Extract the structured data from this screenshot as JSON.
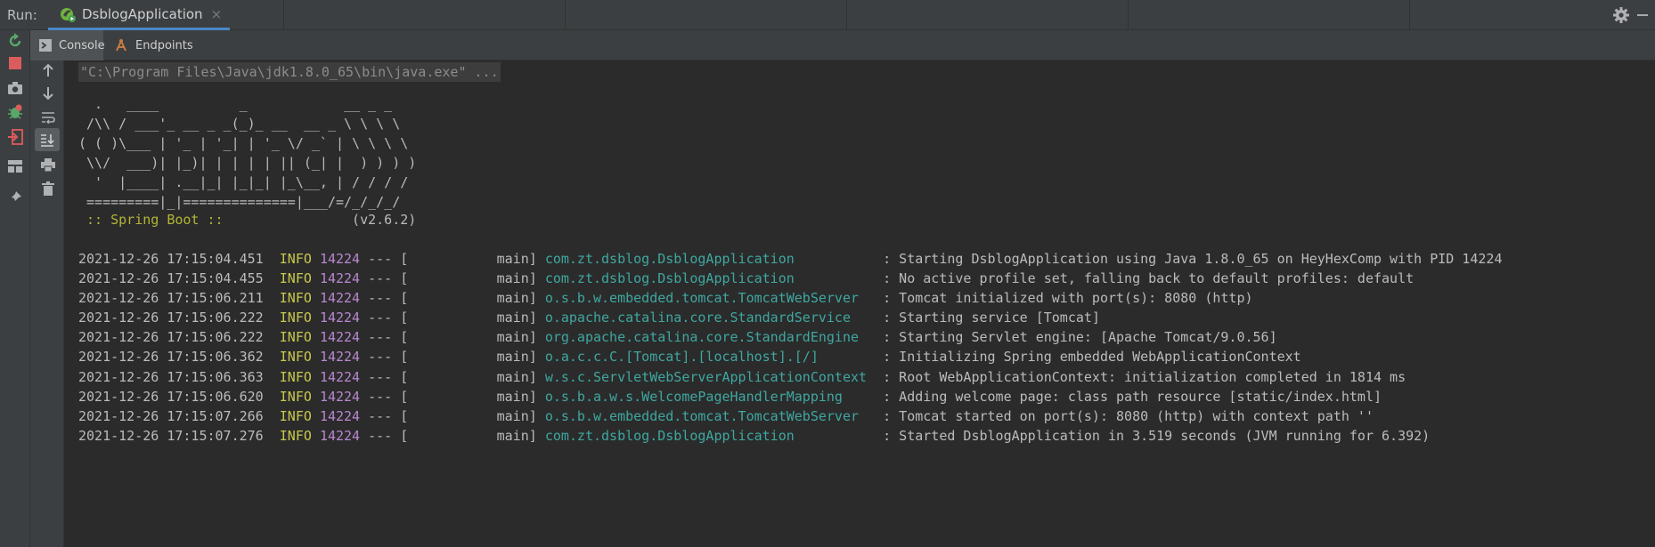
{
  "runbar": {
    "label": "Run:",
    "tab_title": "DsblogApplication",
    "close_glyph": "×"
  },
  "subtabs": [
    {
      "label": "Console",
      "icon": "console-icon"
    },
    {
      "label": "Endpoints",
      "icon": "endpoints-icon"
    }
  ],
  "console": {
    "command": "\"C:\\Program Files\\Java\\jdk1.8.0_65\\bin\\java.exe\" ...",
    "banner": "  .   ____          _            __ _ _\n /\\\\ / ___'_ __ _ _(_)_ __  __ _ \\ \\ \\ \\\n( ( )\\___ | '_ | '_| | '_ \\/ _` | \\ \\ \\ \\\n \\\\/  ___)| |_)| | | | | || (_| |  ) ) ) )\n  '  |____| .__|_| |_|_| |_\\__, | / / / /\n =========|_|==============|___/=/_/_/_/",
    "spring_label": " :: Spring Boot :: ",
    "spring_version": "               (v2.6.2)",
    "logs": [
      {
        "ts": "2021-12-26 17:15:04.451",
        "level": "INFO",
        "pid": "14224",
        "thread": " --- [           main] ",
        "logger": "com.zt.dsblog.DsblogApplication          ",
        "msg": " : Starting DsblogApplication using Java 1.8.0_65 on HeyHexComp with PID 14224"
      },
      {
        "ts": "2021-12-26 17:15:04.455",
        "level": "INFO",
        "pid": "14224",
        "thread": " --- [           main] ",
        "logger": "com.zt.dsblog.DsblogApplication          ",
        "msg": " : No active profile set, falling back to default profiles: default"
      },
      {
        "ts": "2021-12-26 17:15:06.211",
        "level": "INFO",
        "pid": "14224",
        "thread": " --- [           main] ",
        "logger": "o.s.b.w.embedded.tomcat.TomcatWebServer  ",
        "msg": " : Tomcat initialized with port(s): 8080 (http)"
      },
      {
        "ts": "2021-12-26 17:15:06.222",
        "level": "INFO",
        "pid": "14224",
        "thread": " --- [           main] ",
        "logger": "o.apache.catalina.core.StandardService   ",
        "msg": " : Starting service [Tomcat]"
      },
      {
        "ts": "2021-12-26 17:15:06.222",
        "level": "INFO",
        "pid": "14224",
        "thread": " --- [           main] ",
        "logger": "org.apache.catalina.core.StandardEngine  ",
        "msg": " : Starting Servlet engine: [Apache Tomcat/9.0.56]"
      },
      {
        "ts": "2021-12-26 17:15:06.362",
        "level": "INFO",
        "pid": "14224",
        "thread": " --- [           main] ",
        "logger": "o.a.c.c.C.[Tomcat].[localhost].[/]       ",
        "msg": " : Initializing Spring embedded WebApplicationContext"
      },
      {
        "ts": "2021-12-26 17:15:06.363",
        "level": "INFO",
        "pid": "14224",
        "thread": " --- [           main] ",
        "logger": "w.s.c.ServletWebServerApplicationContext ",
        "msg": " : Root WebApplicationContext: initialization completed in 1814 ms"
      },
      {
        "ts": "2021-12-26 17:15:06.620",
        "level": "INFO",
        "pid": "14224",
        "thread": " --- [           main] ",
        "logger": "o.s.b.a.w.s.WelcomePageHandlerMapping    ",
        "msg": " : Adding welcome page: class path resource [static/index.html]"
      },
      {
        "ts": "2021-12-26 17:15:07.266",
        "level": "INFO",
        "pid": "14224",
        "thread": " --- [           main] ",
        "logger": "o.s.b.w.embedded.tomcat.TomcatWebServer  ",
        "msg": " : Tomcat started on port(s): 8080 (http) with context path ''"
      },
      {
        "ts": "2021-12-26 17:15:07.276",
        "level": "INFO",
        "pid": "14224",
        "thread": " --- [           main] ",
        "logger": "com.zt.dsblog.DsblogApplication          ",
        "msg": " : Started DsblogApplication in 3.519 seconds (JVM running for 6.392)"
      }
    ]
  },
  "colors": {
    "background": "#2b2b2b",
    "panel": "#3c3f41",
    "accent": "#4a88c7",
    "level": "#c8c84f",
    "pid": "#b987d1",
    "logger": "#3fa7a0",
    "spring": "#b4b436"
  }
}
